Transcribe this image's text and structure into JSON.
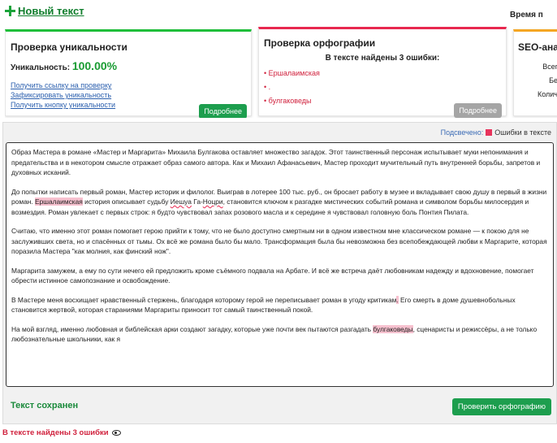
{
  "header": {
    "new_text_link": "Новый текст",
    "time_label": "Время п"
  },
  "uniqueness": {
    "title": "Проверка уникальности",
    "label": "Уникальность:",
    "value": "100.00%",
    "links": [
      "Получить ссылку на проверку",
      "Зафиксировать уникальность",
      "Получить кнопку уникальности"
    ],
    "details_button": "Подробнее"
  },
  "spelling": {
    "title": "Проверка орфографии",
    "found_text": "В тексте найдены 3 ошибки:",
    "errors": [
      "Ершалаимская",
      ".",
      "булгаковеды"
    ],
    "details_button": "Подробнее"
  },
  "seo": {
    "title": "SEO-ана",
    "rows": [
      "Всег",
      "Бе",
      "Колич"
    ]
  },
  "editor": {
    "legend_prefix": "Подсвечено:",
    "legend_label": "Ошибки в тексте",
    "paragraphs": [
      [
        {
          "t": "Образ Мастера в романе «Мастер и Маргарита» Михаила Булгакова оставляет множество загадок. Этот таинственный персонаж испытывает муки непонимания и предательства и в некотором смысле отражает образ самого автора. Как и Михаил Афанасьевич, Мастер проходит мучительный путь внутренней борьбы, запретов и духовных исканий."
        }
      ],
      [
        {
          "t": "До попытки написать первый роман, Мастер историк и филолог. Выиграв в лотерее 100 тыс. руб., он бросает работу в музее и вкладывает свою душу в первый в жизни роман. "
        },
        {
          "t": "Ершалаимская",
          "hl": true
        },
        {
          "t": " история описывает судьбу "
        },
        {
          "t": "Иешуа",
          "ul": true
        },
        {
          "t": " Га-"
        },
        {
          "t": "Ноцри",
          "ul": true
        },
        {
          "t": ", становится ключом к разгадке мистических событий романа и символом борьбы милосердия и возмездия. Роман увлекает с первых строк: я будто чувствовал запах розового масла и к середине я чувствовал головную боль Понтия Пилата."
        }
      ],
      [
        {
          "t": "Считаю, что именно этот роман помогает герою прийти к тому, что не было доступно смертным ни в одном известном мне классическом романе — к покою для не заслуживших света, но и спасённых от тьмы. Ох всё же романа было бы мало. Трансформация была бы невозможна без всепобеждающей любви к Маргарите, которая поразила Мастера \"как молния, как финский нож\"."
        }
      ],
      [
        {
          "t": "Маргарита замужем, а ему по сути нечего ей предложить кроме съёмного подвала на Арбате. И всё же встреча даёт любовникам надежду и вдохновение, помогает обрести истинное самопознание и освобождение."
        }
      ],
      [
        {
          "t": "В Мастере меня восхищает нравственный стержень, благодаря которому герой не переписывает роман в угоду критикам"
        },
        {
          "t": ".",
          "hl": true
        },
        {
          "t": " Его смерть в доме душевнобольных становится жертвой, которая стараниями Маргариты приносит тот самый таинственный покой."
        }
      ],
      [
        {
          "t": "На мой взгляд, именно любовная и библейская арки создают загадку, которые уже почти век пытаются разгадать "
        },
        {
          "t": "булгаковеды",
          "hl": true
        },
        {
          "t": ", сценаристы и режиссёры, а не только любознательные школьники, как я"
        }
      ]
    ],
    "saved_label": "Текст сохранен",
    "check_button": "Проверить орфографию"
  },
  "bottom": {
    "status": "В тексте найдены 3 ошибки",
    "icon": "eye-icon"
  },
  "colors": {
    "accent_green": "#1d9e4e",
    "error_red": "#e8284f",
    "highlight": "#f7c1cf",
    "link_blue": "#2b5fae",
    "seo_orange": "#f5a623"
  }
}
